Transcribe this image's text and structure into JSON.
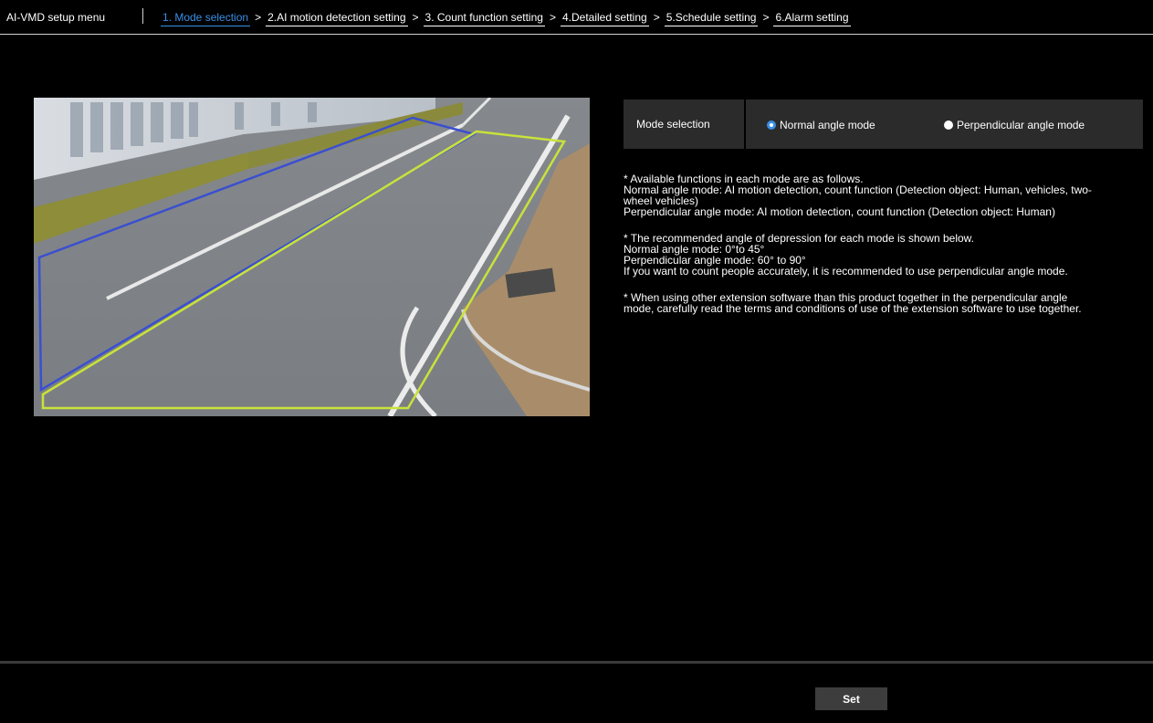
{
  "header": {
    "app_title": "AI-VMD setup menu",
    "steps": [
      {
        "label": "1. Mode selection",
        "active": true
      },
      {
        "label": "2.AI motion detection setting",
        "active": false
      },
      {
        "label": "3. Count function setting",
        "active": false
      },
      {
        "label": "4.Detailed setting",
        "active": false
      },
      {
        "label": "5.Schedule setting",
        "active": false
      },
      {
        "label": "6.Alarm setting",
        "active": false
      }
    ],
    "separator": ">"
  },
  "preview": {
    "area_colors": {
      "blue_area": "#3a4fd0",
      "green_area": "#c9e23a"
    }
  },
  "mode_selection": {
    "label": "Mode selection",
    "options": [
      {
        "label": "Normal angle mode",
        "selected": true
      },
      {
        "label": "Perpendicular angle mode",
        "selected": false
      }
    ]
  },
  "info": {
    "block1": {
      "line1": "* Available functions in each mode are as follows.",
      "line2": "Normal angle mode: AI motion detection, count function (Detection object: Human, vehicles, two-",
      "line3": "wheel vehicles)",
      "line4": "Perpendicular angle mode: AI motion detection, count function (Detection object: Human)"
    },
    "block2": {
      "line1": "* The recommended angle of depression for each mode is shown below.",
      "line2": "Normal angle mode: 0°to 45°",
      "line3": "Perpendicular angle mode: 60° to 90°",
      "line4": "If you want to count people accurately, it is recommended to use perpendicular angle mode."
    },
    "block3": {
      "line1": "* When using other extension software than this product together in the perpendicular angle",
      "line2": "mode, carefully read the terms and conditions of use of the extension software to use together."
    }
  },
  "footer": {
    "set_label": "Set"
  },
  "colors": {
    "accent": "#3a8fe8",
    "background": "#000000",
    "panel": "#2b2b2b"
  }
}
